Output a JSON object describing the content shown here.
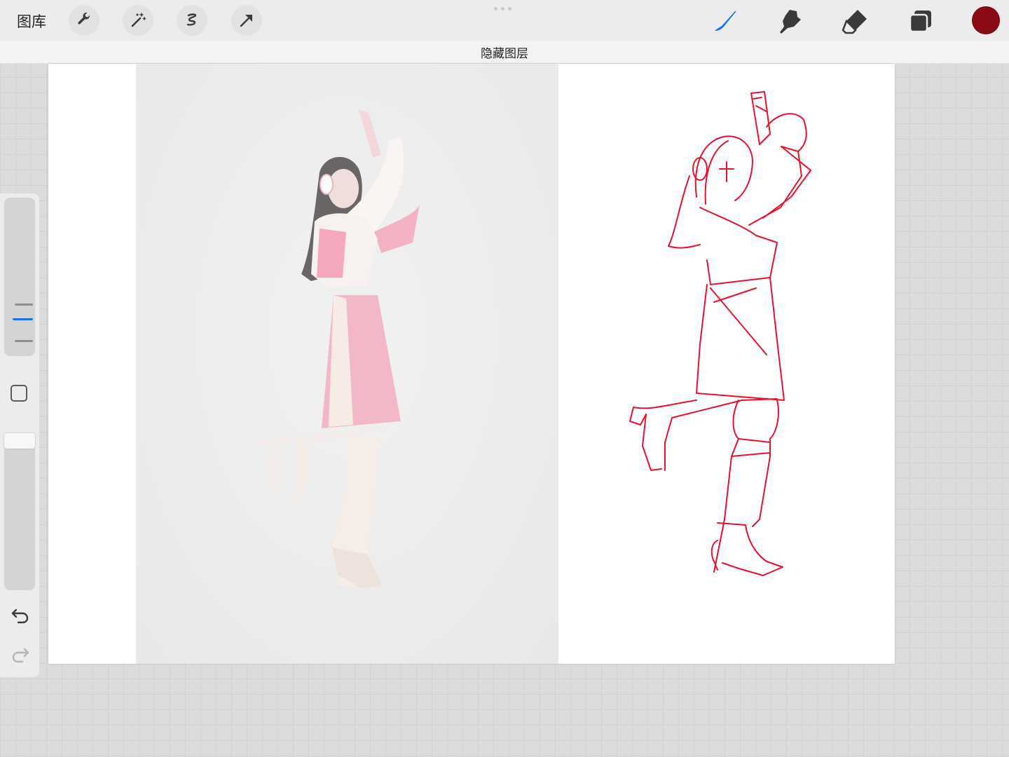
{
  "toolbar": {
    "gallery_label": "图库",
    "left_tools": [
      "wrench-icon",
      "magic-wand-icon",
      "selection-icon",
      "arrow-icon"
    ],
    "right_tools": [
      "brush-icon",
      "smudge-icon",
      "eraser-icon",
      "layers-icon"
    ],
    "active_color": "#8a0a16",
    "active_tool_color": "#1a73e8"
  },
  "notice": {
    "text": "隐藏图层"
  },
  "canvas": {
    "sketch_color": "#e8102e"
  },
  "sidebar": {
    "brush_size_icon": "size-slider",
    "modifier_icon": "square-modifier-icon",
    "undo_icon": "undo-icon",
    "redo_icon": "redo-icon"
  }
}
